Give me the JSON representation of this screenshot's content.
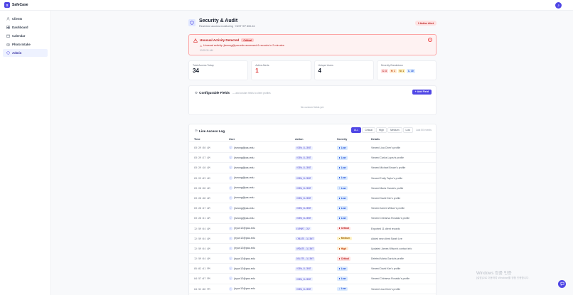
{
  "app": {
    "logo_letter": "S",
    "name": "SafeCase",
    "user_initial": "J"
  },
  "sidebar": {
    "items": [
      {
        "label": "Clients",
        "icon": "users-icon"
      },
      {
        "label": "Dashboard",
        "icon": "dashboard-icon"
      },
      {
        "label": "Calendar",
        "icon": "calendar-icon"
      },
      {
        "label": "Photo Intake",
        "icon": "camera-icon"
      },
      {
        "label": "Admin",
        "icon": "shield-icon",
        "active": true
      }
    ]
  },
  "header": {
    "title": "Security & Audit",
    "subtitle": "Real-time access monitoring · NIST SP 800-61",
    "alert_pill": "1 Active Alert"
  },
  "alert": {
    "title": "Unusual Activity Detected",
    "badge": "Critical",
    "message": "Unusual activity: jlseong@pau.edu accessed 6 records in 2 minutes",
    "time": "03:29:31 AM"
  },
  "stats": {
    "total_label": "Total Access Today",
    "total_value": "34",
    "alerts_label": "Active Alerts",
    "alerts_value": "1",
    "users_label": "Unique Users",
    "users_value": "4",
    "breakdown_label": "Severity Breakdown",
    "breakdown": {
      "critical": "C: 3",
      "high": "H: 1",
      "medium": "M: 1",
      "low": "L: 30"
    }
  },
  "fields": {
    "title": "Configurable Fields",
    "hint": "— add custom fields to client profiles",
    "add_label": "+ Add Field",
    "empty": "No custom fields yet."
  },
  "log": {
    "title": "Live Access Log",
    "filters": [
      "ALL",
      "Critical",
      "High",
      "Medium",
      "Low"
    ],
    "filter_note": "Last 50 events",
    "columns": {
      "time": "Time",
      "user": "User",
      "action": "Action",
      "severity": "Severity",
      "details": "Details"
    },
    "rows": [
      {
        "time": "03:29:30 AM",
        "user": "jlseong@pau.edu",
        "action": "VIEW_CLIENT",
        "severity": "Low",
        "details": "Viewed Lisa Chen's profile"
      },
      {
        "time": "03:29:27 AM",
        "user": "jlseong@pau.edu",
        "action": "VIEW_CLIENT",
        "severity": "Low",
        "details": "Viewed Carlos Lopez's profile"
      },
      {
        "time": "03:29:10 AM",
        "user": "jlseong@pau.edu",
        "action": "VIEW_CLIENT",
        "severity": "Low",
        "details": "Viewed Michael Brown's profile"
      },
      {
        "time": "03:29:03 AM",
        "user": "jlseong@pau.edu",
        "action": "VIEW_CLIENT",
        "severity": "Low",
        "details": "Viewed Emily Taylor's profile"
      },
      {
        "time": "03:28:58 AM",
        "user": "jlseong@pau.edu",
        "action": "VIEW_CLIENT",
        "severity": "Low",
        "details": "Viewed Maria Garcia's profile"
      },
      {
        "time": "03:28:48 AM",
        "user": "jlseong@pau.edu",
        "action": "VIEW_CLIENT",
        "severity": "Low",
        "details": "Viewed David Kim's profile"
      },
      {
        "time": "03:28:47 AM",
        "user": "jlseong@pau.edu",
        "action": "VIEW_CLIENT",
        "severity": "Low",
        "details": "Viewed James Wilson's profile"
      },
      {
        "time": "03:28:41 AM",
        "user": "jlseong@pau.edu",
        "action": "VIEW_CLIENT",
        "severity": "Low",
        "details": "Viewed Chiriaeva Ronaldo's profile"
      },
      {
        "time": "12:59:54 AM",
        "user": "jhyun12@pau.edu",
        "action": "EXPORT_CSV",
        "severity": "Critical",
        "details": "Exported 11 client records"
      },
      {
        "time": "12:59:54 AM",
        "user": "jhyun12@pau.edu",
        "action": "CREATE_CLIENT",
        "severity": "Medium",
        "details": "Added new client Sarah Lee"
      },
      {
        "time": "12:59:54 AM",
        "user": "jhyun12@pau.edu",
        "action": "UPDATE_CLIENT",
        "severity": "High",
        "details": "Updated James Wilson's contact info"
      },
      {
        "time": "12:59:54 AM",
        "user": "jhyun12@pau.edu",
        "action": "DELETE_CLIENT",
        "severity": "Critical",
        "details": "Deleted Maria Garcia's profile"
      },
      {
        "time": "05:02:41 PM",
        "user": "jhyun12@pau.edu",
        "action": "VIEW_CLIENT",
        "severity": "Low",
        "details": "Viewed David Kim's profile"
      },
      {
        "time": "04:57:07 PM",
        "user": "jhyun12@pau.edu",
        "action": "VIEW_CLIENT",
        "severity": "Low",
        "details": "Viewed Chiriaeva Ronaldo's profile"
      },
      {
        "time": "04:52:06 PM",
        "user": "jhyun12@pau.edu",
        "action": "VIEW_CLIENT",
        "severity": "Low",
        "details": "Viewed Lisa Chen's profile"
      }
    ]
  },
  "watermark": {
    "line1": "Windows 정품 인증",
    "line2": "[설정]으로 이동하여 Windows를 정품 인증합니다."
  },
  "colors": {
    "accent": "#4f46e5",
    "danger": "#dc2626"
  }
}
